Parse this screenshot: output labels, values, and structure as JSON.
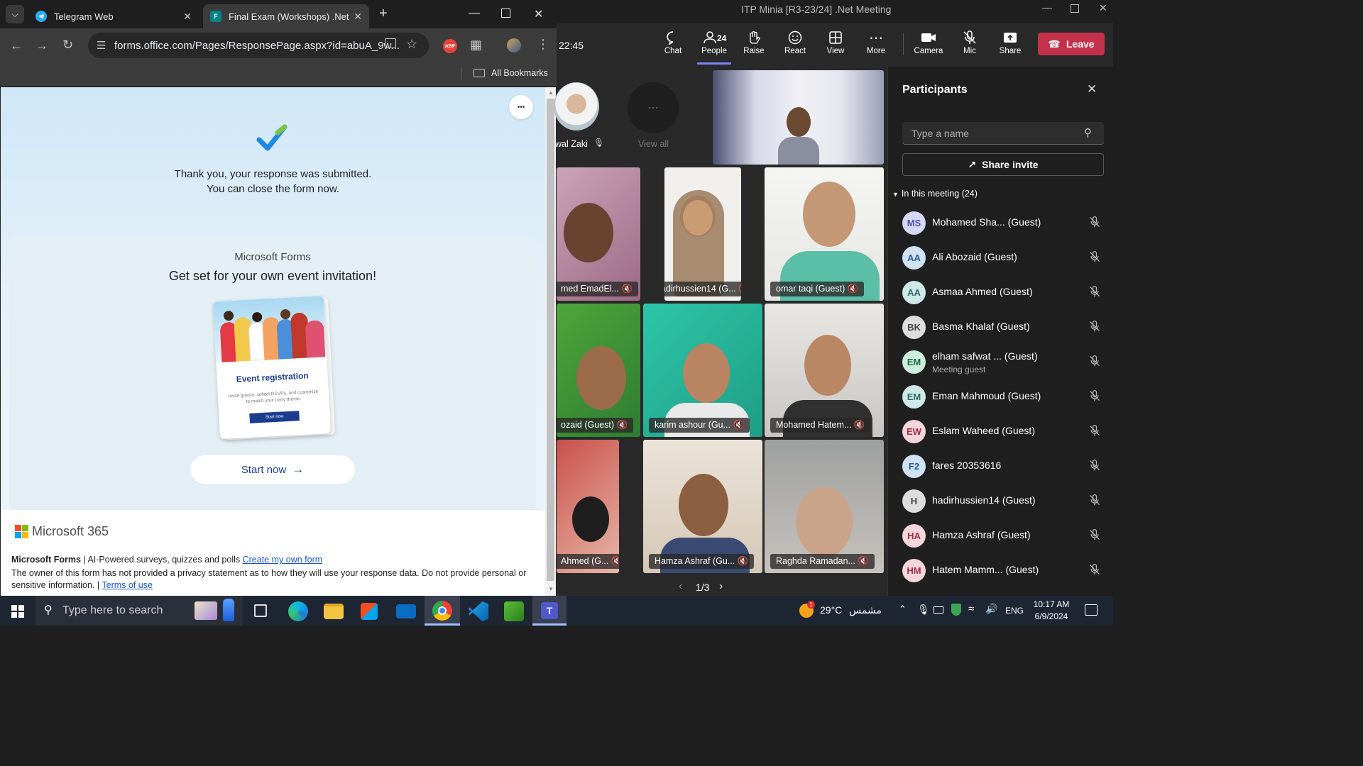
{
  "browser": {
    "tabs": [
      {
        "label": "Telegram Web",
        "icon": "telegram-icon"
      },
      {
        "label": "Final Exam (Workshops) .Net Q",
        "icon": "forms-icon"
      }
    ],
    "new_tab": "+",
    "url": "forms.office.com/Pages/ResponsePage.aspx?id=abuA_9w...",
    "bookmarks_label": "All Bookmarks",
    "extension_abp": "ABP"
  },
  "form": {
    "thank_you_line1": "Thank you, your response was submitted.",
    "thank_you_line2": "You can close the form now.",
    "more_button": "•••",
    "promo_brand": "Microsoft Forms",
    "promo_heading": "Get set for your own event invitation!",
    "card_title": "Event registration",
    "card_body": "Invite guests, collect RSVPs, and customize to match your party theme.",
    "card_button": "Start now",
    "start_button": "Start now",
    "ms365": "Microsoft 365",
    "footer_brand": "Microsoft Forms",
    "footer_tagline": " | AI-Powered surveys, quizzes and polls ",
    "footer_create": "Create my own form",
    "footer_privacy": "The owner of this form has not provided a privacy statement as to how they will use your response data. Do not provide personal or sensitive information. | ",
    "footer_terms": "Terms of use"
  },
  "teams": {
    "window_title": "ITP Minia [R3-23/24] .Net Meeting",
    "timer": "22:45",
    "toolbar": [
      {
        "label": "Chat",
        "icon": "chat-icon"
      },
      {
        "label": "People",
        "icon": "people-icon",
        "badge": "24"
      },
      {
        "label": "Raise",
        "icon": "hand-icon"
      },
      {
        "label": "React",
        "icon": "smile-icon"
      },
      {
        "label": "View",
        "icon": "grid-icon"
      },
      {
        "label": "More",
        "icon": "more-icon"
      },
      {
        "label": "Camera",
        "icon": "camera-icon"
      },
      {
        "label": "Mic",
        "icon": "mic-off-icon"
      },
      {
        "label": "Share",
        "icon": "share-icon"
      }
    ],
    "leave": "Leave",
    "top_strip": {
      "name": "wal Zaki",
      "view_all": "View all"
    },
    "tiles": [
      "med EmadEl...",
      "hadirhussien14 (G...",
      "omar taqi (Guest)",
      "ozaid (Guest)",
      "karim ashour (Gu...",
      "Mohamed Hatem...",
      "Ahmed (G...",
      "Hamza Ashraf (Gu...",
      "Raghda Ramadan..."
    ],
    "pager": "1/3",
    "participants": {
      "title": "Participants",
      "search_placeholder": "Type a name",
      "share_invite": "Share invite",
      "section": "In this meeting (24)",
      "list": [
        {
          "initials": "MS",
          "name": "Mohamed Sha...  (Guest)",
          "sub": "",
          "color": "#d5d9f5",
          "fg": "#4f52b2"
        },
        {
          "initials": "AA",
          "name": "Ali Abozaid (Guest)",
          "sub": "",
          "color": "#cfe3f5",
          "fg": "#2a5a8f"
        },
        {
          "initials": "AA",
          "name": "Asmaa Ahmed (Guest)",
          "sub": "",
          "color": "#cfe8e8",
          "fg": "#2d6a6a"
        },
        {
          "initials": "BK",
          "name": "Basma Khalaf (Guest)",
          "sub": "",
          "color": "#dddddd",
          "fg": "#444444"
        },
        {
          "initials": "EM",
          "name": "elham safwat ...     (Guest)",
          "sub": "Meeting guest",
          "color": "#cdeedd",
          "fg": "#1f6b44"
        },
        {
          "initials": "EM",
          "name": "Eman Mahmoud (Guest)",
          "sub": "",
          "color": "#cfe8e8",
          "fg": "#2d6a6a"
        },
        {
          "initials": "EW",
          "name": "Eslam Waheed (Guest)",
          "sub": "",
          "color": "#f5d6dc",
          "fg": "#9b2f44"
        },
        {
          "initials": "F2",
          "name": "fares 20353616",
          "sub": "",
          "color": "#cfe3f5",
          "fg": "#2a5a8f"
        },
        {
          "initials": "H",
          "name": "hadirhussien14 (Guest)",
          "sub": "",
          "color": "#dddddd",
          "fg": "#444444"
        },
        {
          "initials": "HA",
          "name": "Hamza Ashraf (Guest)",
          "sub": "",
          "color": "#f5d6dc",
          "fg": "#9b2f44"
        },
        {
          "initials": "HM",
          "name": "Hatem Mamm...  (Guest)",
          "sub": "",
          "color": "#f5d6dc",
          "fg": "#9b2f44"
        }
      ]
    }
  },
  "taskbar": {
    "search_placeholder": "Type here to search",
    "weather": "29°C",
    "weather_label": "مشمس",
    "weather_badge": "1",
    "language": "ENG",
    "time": "10:17 AM",
    "date": "6/9/2024"
  }
}
